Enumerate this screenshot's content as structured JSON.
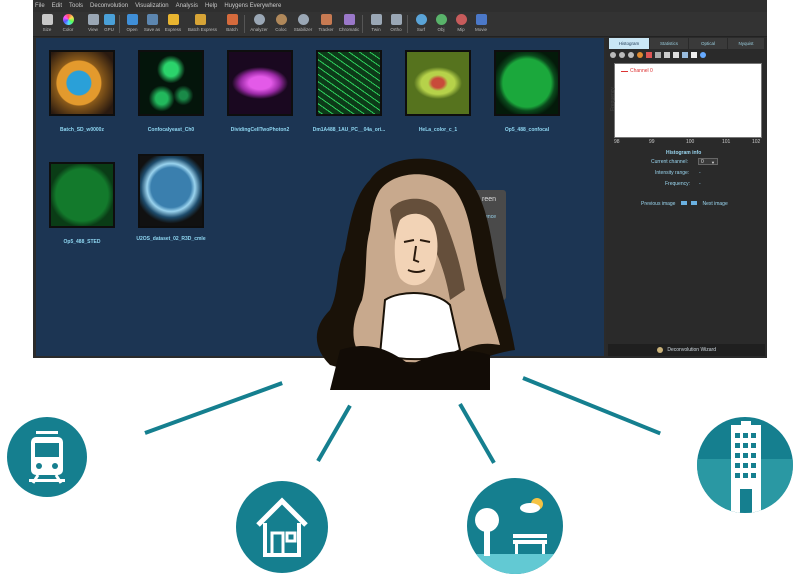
{
  "menu": [
    "File",
    "Edit",
    "Tools",
    "Deconvolution",
    "Visualization",
    "Analysis",
    "Help",
    "Huygens Everywhere"
  ],
  "toolbar": [
    {
      "label": "Size",
      "icon": "size-icon",
      "color": "#c8c8c8"
    },
    {
      "label": "Color",
      "icon": "color-wheel-icon",
      "color": "#e08ad6"
    },
    {
      "label": "View",
      "icon": "view-icon",
      "color": "#9aa7b5"
    },
    {
      "label": "GPU",
      "icon": "gpu-icon",
      "color": "#4aa0d8"
    },
    {
      "label": "Open",
      "icon": "open-icon",
      "color": "#3f8fd8"
    },
    {
      "label": "Save as",
      "icon": "save-icon",
      "color": "#5c86b0"
    },
    {
      "label": "Express",
      "icon": "express-icon",
      "color": "#e9b530"
    },
    {
      "label": "Batch Express",
      "icon": "batch-express-icon",
      "color": "#d7a436"
    },
    {
      "label": "Batch",
      "icon": "batch-icon",
      "color": "#d56a3c"
    },
    {
      "label": "Analyzer",
      "icon": "analyzer-icon",
      "color": "#9aa7b5"
    },
    {
      "label": "Coloc",
      "icon": "coloc-icon",
      "color": "#b0885a"
    },
    {
      "label": "Stabilizer",
      "icon": "stabilizer-icon",
      "color": "#9aa7b5"
    },
    {
      "label": "Tracker",
      "icon": "tracker-icon",
      "color": "#c77a52"
    },
    {
      "label": "Chromatic",
      "icon": "chromatic-icon",
      "color": "#9a78c9"
    },
    {
      "label": "Twin",
      "icon": "twin-icon",
      "color": "#9aa7b5"
    },
    {
      "label": "Ortho",
      "icon": "ortho-icon",
      "color": "#9aa7b5"
    },
    {
      "label": "Surf",
      "icon": "surf-icon",
      "color": "#5aa4d8"
    },
    {
      "label": "Obj",
      "icon": "obj-icon",
      "color": "#59b36a"
    },
    {
      "label": "Mip",
      "icon": "mip-icon",
      "color": "#c75b5b"
    },
    {
      "label": "Movie",
      "icon": "movie-icon",
      "color": "#4b78c8"
    }
  ],
  "gallery": [
    {
      "caption": "Batch_SD_w0000z",
      "image": "cell-orange-blue"
    },
    {
      "caption": "Confocalyeast_Ch0",
      "image": "yeast-green-dots"
    },
    {
      "caption": "DividingCellTwoPhoton2",
      "image": "magenta-spindle"
    },
    {
      "caption": "Dm1A488_1AU_PC__04a_ori...",
      "image": "green-fibers"
    },
    {
      "caption": "HeLa_color_c_1",
      "image": "hela-yellow-green"
    },
    {
      "caption": "Op5_488_confocal",
      "image": "green-blob"
    },
    {
      "caption": "Op5_488_STED",
      "image": "green-blob-sted"
    },
    {
      "caption": "U2OS_dataset_02_R3D_cmle",
      "image": "u2os-rendered"
    }
  ],
  "panel": {
    "tabs": [
      "Histogram",
      "Statistics",
      "Optical",
      "Nyquist"
    ],
    "active_tab": "Histogram",
    "legend": "Channel 0",
    "ylabel": "Frequency",
    "xticks": [
      "98",
      "99",
      "100",
      "101",
      "102"
    ],
    "info_title": "Histogram info",
    "current_channel_label": "Current channel:",
    "current_channel_value": "0",
    "intensity_label": "Intensity range:",
    "intensity_value": "-",
    "frequency_label": "Frequency:",
    "frequency_value": "-",
    "prev_label": "Previous image",
    "next_label": "Next image",
    "wizard_label": "Deconvolution Wizard"
  },
  "partial_dialog": {
    "title": "reen",
    "text": "ence"
  },
  "colors": {
    "accent": "#157f8f",
    "gallery_bg": "#1c3553",
    "caption": "#8fd7f2"
  },
  "illustrations": [
    {
      "name": "portrait",
      "description": "christiaan-huygens-portrait"
    },
    {
      "name": "train",
      "icon": "train-icon"
    },
    {
      "name": "house",
      "icon": "house-icon"
    },
    {
      "name": "park",
      "icon": "park-bench-icon"
    },
    {
      "name": "building",
      "icon": "office-building-icon"
    }
  ]
}
